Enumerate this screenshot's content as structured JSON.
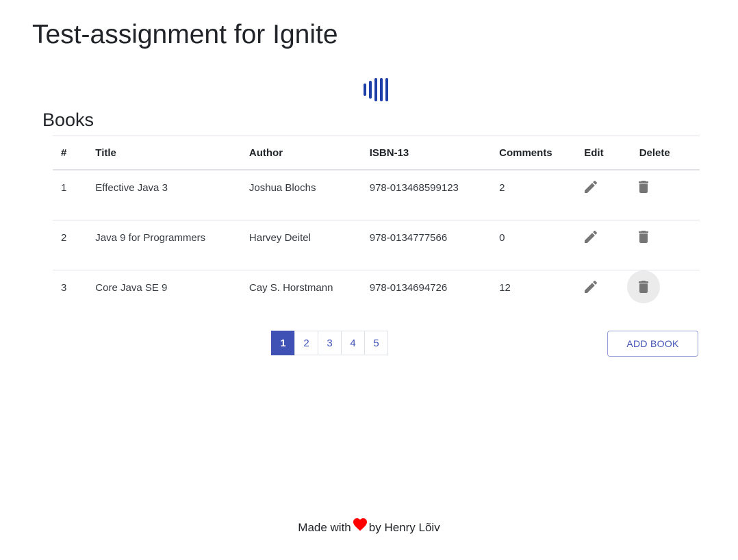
{
  "header": {
    "title": "Test-assignment for Ignite"
  },
  "logo": {
    "icon": "audio-bars-icon",
    "color": "#1f3fa8"
  },
  "books_section": {
    "title": "Books",
    "columns": [
      "#",
      "Title",
      "Author",
      "ISBN-13",
      "Comments",
      "Edit",
      "Delete"
    ],
    "rows": [
      {
        "num": "1",
        "title": "Effective Java 3",
        "author": "Joshua Blochs",
        "isbn": "978-013468599123",
        "comments": "2"
      },
      {
        "num": "2",
        "title": "Java 9 for Programmers",
        "author": "Harvey Deitel",
        "isbn": "978-0134777566",
        "comments": "0"
      },
      {
        "num": "3",
        "title": "Core Java SE 9",
        "author": "Cay S. Horstmann",
        "isbn": "978-0134694726",
        "comments": "12"
      }
    ],
    "edit_icon": "pencil-icon",
    "delete_icon": "trash-icon"
  },
  "pagination": {
    "pages": [
      "1",
      "2",
      "3",
      "4",
      "5"
    ],
    "active": "1"
  },
  "actions": {
    "add_book_label": "ADD BOOK"
  },
  "footer": {
    "made_with": "Made with",
    "by": "by Henry Lõiv",
    "heart_color": "#ff0000"
  },
  "colors": {
    "accent": "#3f51b5",
    "icon_gray": "#757575"
  }
}
